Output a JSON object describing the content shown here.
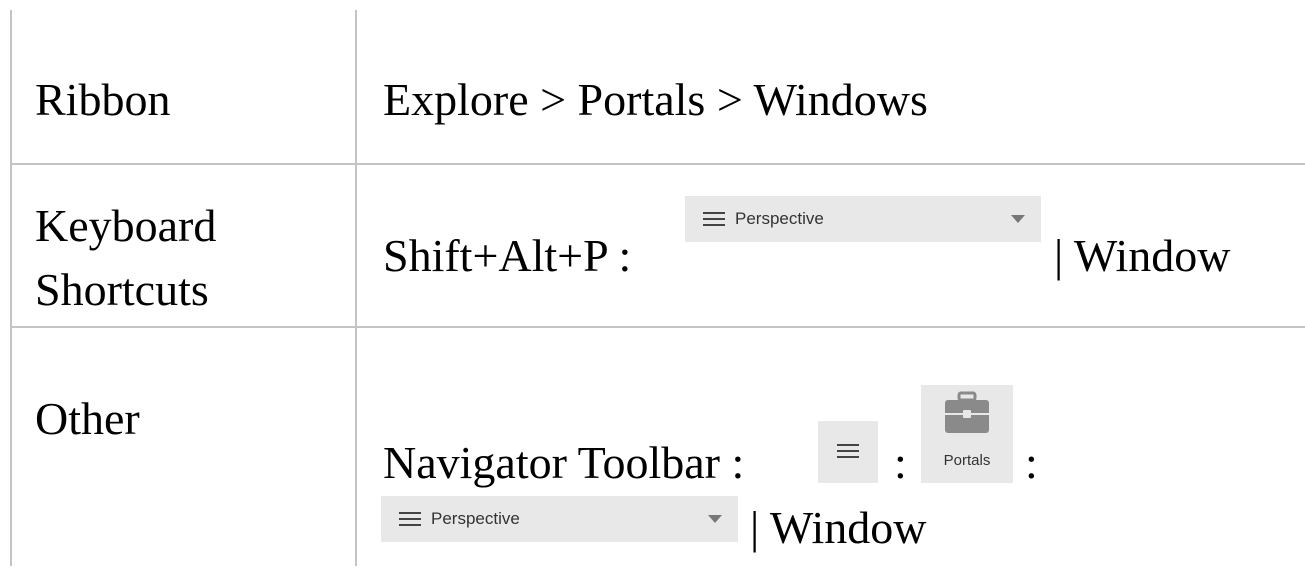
{
  "rows": [
    {
      "label": "Ribbon",
      "value": "Explore > Portals > Windows"
    },
    {
      "label_line1": "Keyboard",
      "label_line2": "Shortcuts",
      "prefix": "Shift+Alt+P :",
      "combo_label": "Perspective",
      "suffix": "| Window"
    },
    {
      "label": "Other",
      "prefix": "Navigator Toolbar :",
      "sep1": ":",
      "portals_label": "Portals",
      "sep2": ":",
      "combo_label": "Perspective",
      "suffix": "| Window"
    }
  ],
  "colors": {
    "grid": "#c4c4c4",
    "widget_bg": "#e8e8e8",
    "briefcase": "#8a8a8a"
  },
  "icons": [
    "hamburger-menu-icon",
    "briefcase-icon",
    "dropdown-arrow-icon"
  ]
}
